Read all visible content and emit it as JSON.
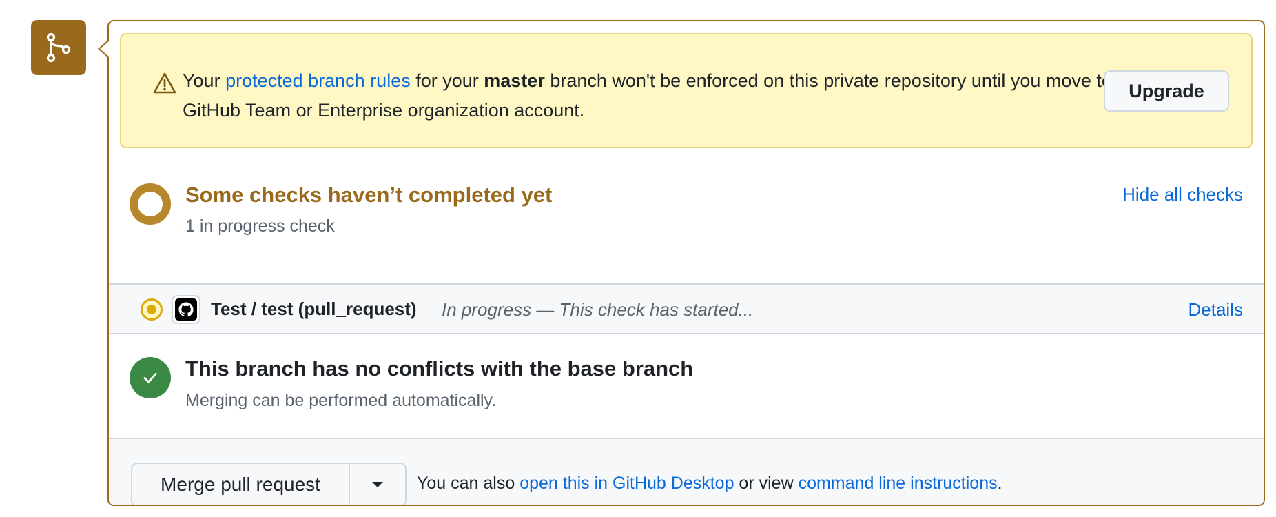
{
  "banner": {
    "text_1": "Your ",
    "link_rules": "protected branch rules",
    "text_2": " for your ",
    "branch": "master",
    "text_3": " branch won't be enforced on this private repository until you move to a GitHub Team or Enterprise organization account.",
    "upgrade_label": "Upgrade",
    "icon": "alert-triangle-icon"
  },
  "checks": {
    "title": "Some checks haven’t completed yet",
    "subtitle": "1 in progress check",
    "toggle_label": "Hide all checks",
    "items": [
      {
        "name": "Test / test (pull_request)",
        "status": "In progress — This check has started...",
        "details_label": "Details",
        "status_color": "#dbab0a",
        "app_icon": "github-icon"
      }
    ]
  },
  "merge_status": {
    "title": "This branch has no conflicts with the base branch",
    "subtitle": "Merging can be performed automatically."
  },
  "footer": {
    "merge_button_label": "Merge pull request",
    "text_1": "You can also ",
    "link_desktop": "open this in GitHub Desktop",
    "text_2": " or view ",
    "link_cli": "command line instructions",
    "text_3": "."
  },
  "colors": {
    "accent_pending": "#9a6a1c",
    "success": "#3a8a45",
    "link": "#0969da",
    "banner_bg": "#fff8c5"
  }
}
